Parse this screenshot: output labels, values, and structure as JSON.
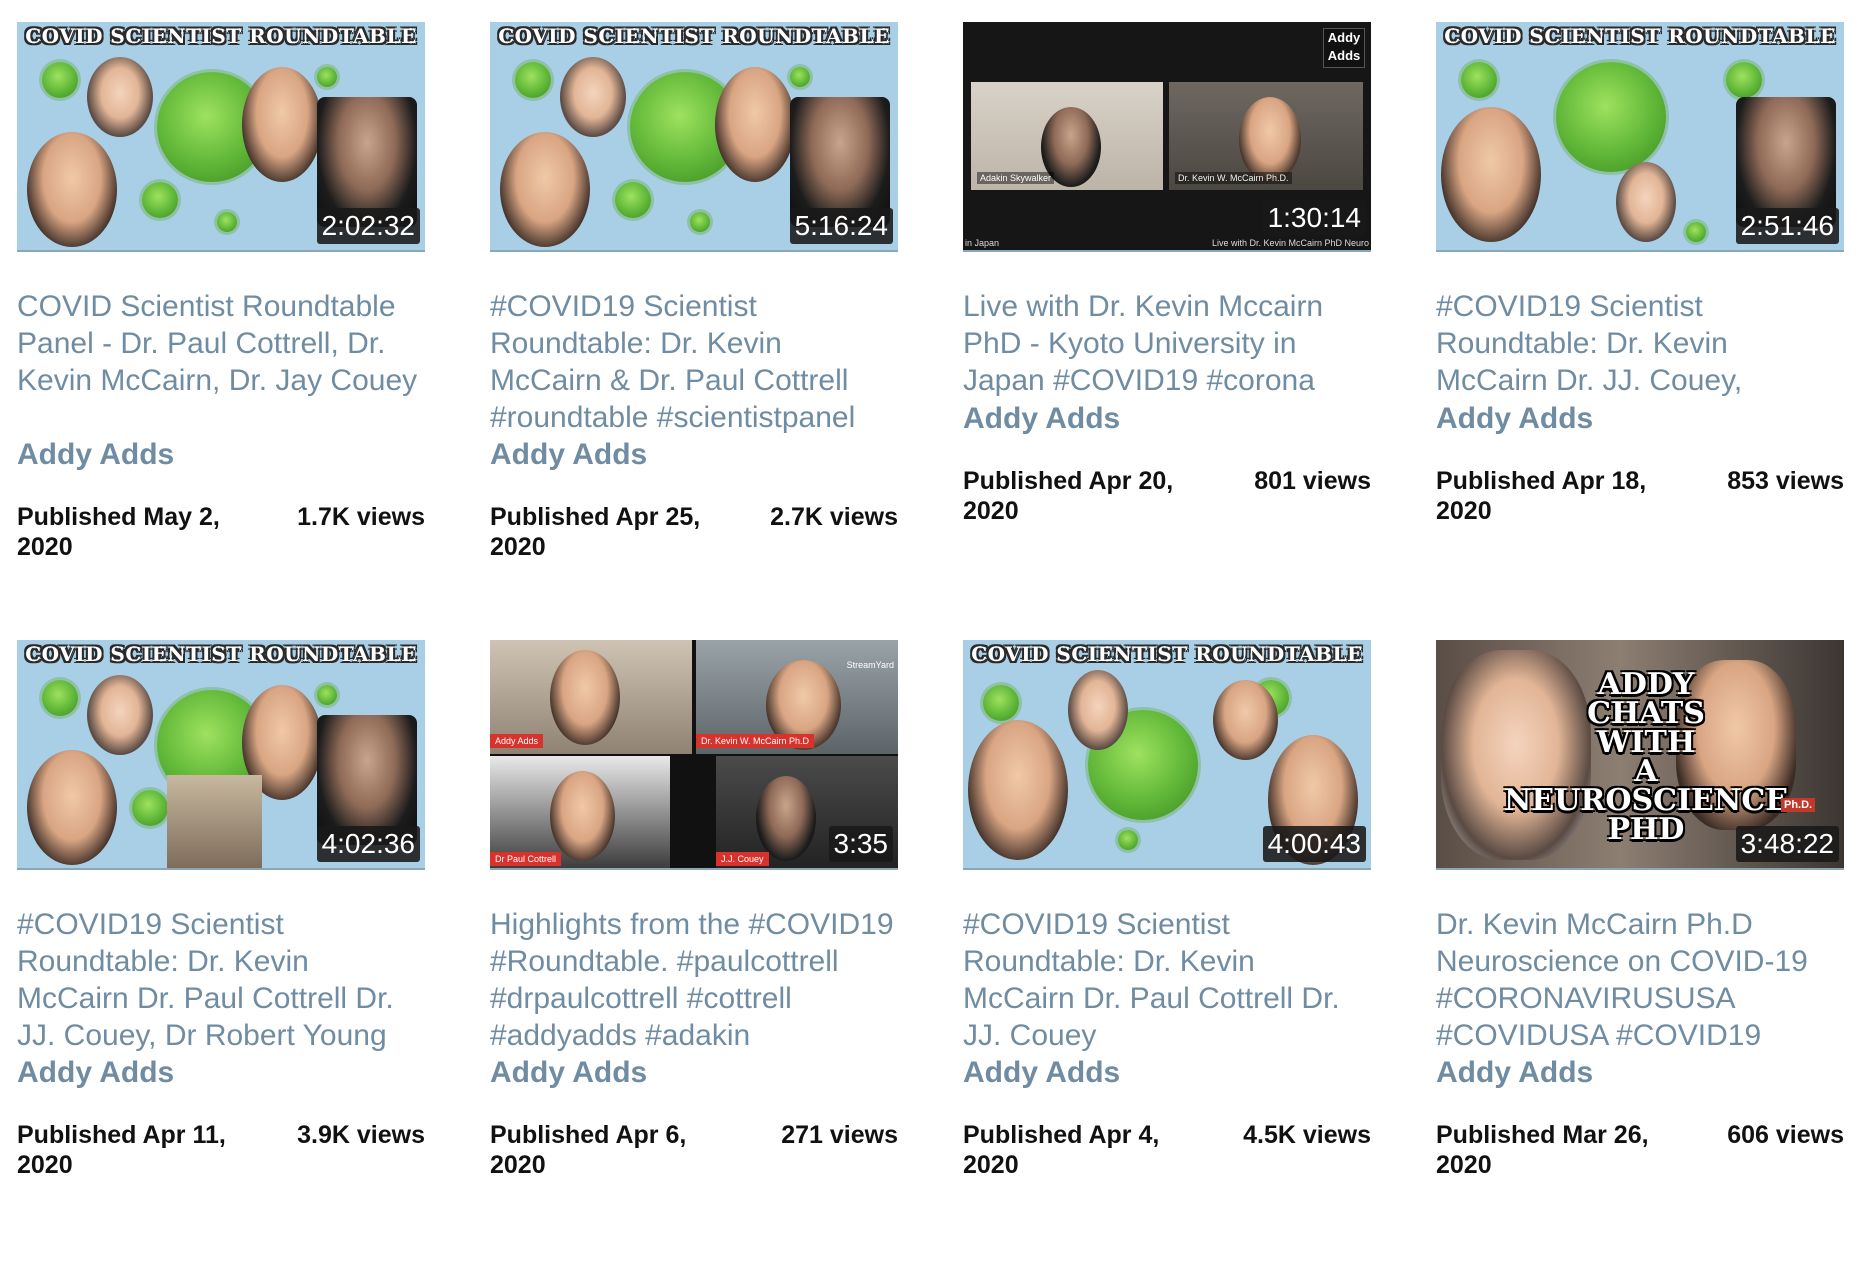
{
  "cards": [
    {
      "thumb_banner": "COVID SCIENTIST ROUNDTABLE",
      "duration": "2:02:32",
      "title": "COVID Scientist Roundtable Panel - Dr. Paul Cottrell, Dr. Kevin McCairn, Dr. Jay Couey",
      "channel": "Addy Adds",
      "published": "Published May 2, 2020",
      "views": "1.7K views"
    },
    {
      "thumb_banner": "COVID SCIENTIST ROUNDTABLE",
      "duration": "5:16:24",
      "title": "#COVID19 Scientist Roundtable: Dr. Kevin McCairn & Dr. Paul Cottrell #roundtable #scientistpanel",
      "channel": "Addy Adds",
      "published": "Published Apr 25, 2020",
      "views": "2.7K views"
    },
    {
      "thumb_logo": "Addy Adds",
      "thumb_left_label": "Adakin Skywalker",
      "thumb_right_label": "Dr. Kevin W. McCairn Ph.D.",
      "thumb_footer_left": "in Japan",
      "thumb_footer_right": "Live with Dr. Kevin McCairn PhD Neuro",
      "duration": "1:30:14",
      "title": "Live with Dr. Kevin Mccairn PhD - Kyoto University in Japan #COVID19 #corona",
      "channel": "Addy Adds",
      "published": "Published Apr 20, 2020",
      "views": "801 views"
    },
    {
      "thumb_banner": "COVID SCIENTIST ROUNDTABLE",
      "duration": "2:51:46",
      "title": "#COVID19 Scientist Roundtable: Dr. Kevin McCairn Dr. JJ. Couey,",
      "channel": "Addy Adds",
      "published": "Published Apr 18, 2020",
      "views": "853 views"
    },
    {
      "thumb_banner": "COVID SCIENTIST ROUNDTABLE",
      "duration": "4:02:36",
      "title": "#COVID19 Scientist Roundtable: Dr. Kevin McCairn Dr. Paul Cottrell Dr. JJ. Couey, Dr Robert Young",
      "channel": "Addy Adds",
      "published": "Published Apr 11, 2020",
      "views": "3.9K views"
    },
    {
      "thumb_labels": [
        "Addy Adds",
        "Dr. Kevin W. McCairn Ph.D",
        "Dr Paul Cottrell",
        "J.J. Couey"
      ],
      "thumb_corner": "StreamYard",
      "duration": "3:35",
      "title": "Highlights from the #COVID19 #Roundtable. #paulcottrell #drpaulcottrell #cottrell #addyadds #adakin",
      "channel": "Addy Adds",
      "published": "Published Apr 6, 2020",
      "views": "271 views"
    },
    {
      "thumb_banner": "COVID SCIENTIST ROUNDTABLE",
      "duration": "4:00:43",
      "title": "#COVID19 Scientist Roundtable: Dr. Kevin McCairn Dr. Paul Cottrell Dr. JJ. Couey",
      "channel": "Addy Adds",
      "published": "Published Apr 4, 2020",
      "views": "4.5K views"
    },
    {
      "thumb_text_lines": [
        "ADDY",
        "CHATS",
        "WITH",
        "A",
        "NEUROSCIENCE",
        "PHD"
      ],
      "thumb_badge": "Ph.D.",
      "duration": "3:48:22",
      "title": "Dr. Kevin McCairn Ph.D Neuroscience on COVID-19 #CORONAVIRUSUSA #COVIDUSA #COVID19",
      "channel": "Addy Adds",
      "published": "Published Mar 26, 2020",
      "views": "606 views"
    }
  ],
  "colors": {
    "link": "#6f8ca3",
    "meta_text": "#111111",
    "thumb_sky": "#a9cfe6",
    "virus_green": "#5fb637",
    "duration_bg": "#191919"
  },
  "icons": [
    "virus-graphic",
    "addy-adds-logo"
  ]
}
